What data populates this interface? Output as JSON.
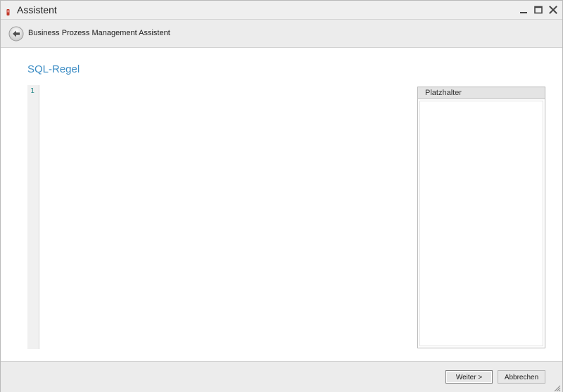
{
  "window": {
    "title": "Assistent"
  },
  "header": {
    "title": "Business Prozess Management Assistent"
  },
  "main": {
    "page_title": "SQL-Regel",
    "editor": {
      "line_numbers": [
        "1"
      ],
      "content": ""
    },
    "placeholder_panel": {
      "header": "Platzhalter",
      "items": []
    }
  },
  "footer": {
    "next_label": "Weiter >",
    "cancel_label": "Abbrechen"
  },
  "colors": {
    "accent": "#3c8cc4",
    "app_icon": "#c0392b",
    "line_number": "#2a8a8a"
  },
  "icons": {
    "app": "app-icon",
    "minimize": "minimize-icon",
    "maximize": "maximize-icon",
    "close": "close-icon",
    "back": "back-arrow-icon",
    "resize": "resize-grip-icon"
  }
}
